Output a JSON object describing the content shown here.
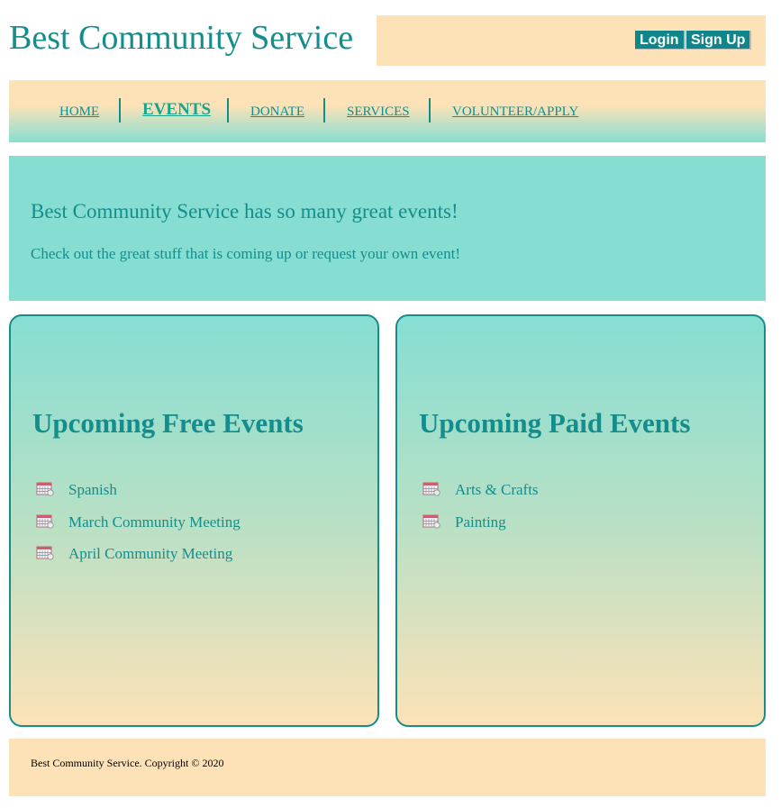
{
  "header": {
    "title": "Best Community Service",
    "login_label": "Login",
    "signup_label": "Sign Up"
  },
  "nav": {
    "items": [
      {
        "label": "HOME"
      },
      {
        "label": "EVENTS",
        "active": true
      },
      {
        "label": "DONATE"
      },
      {
        "label": "SERVICES"
      },
      {
        "label": "VOLUNTEER/APPLY"
      }
    ]
  },
  "hero": {
    "heading": "Best Community Service has so many great events!",
    "text": "Check out the great stuff that is coming up or request your own event!"
  },
  "free_events": {
    "title": "Upcoming Free Events",
    "items": [
      {
        "label": "Spanish",
        "icon": "calendar-icon"
      },
      {
        "label": "March Community Meeting",
        "icon": "calendar-icon"
      },
      {
        "label": "April Community Meeting",
        "icon": "calendar-icon"
      }
    ]
  },
  "paid_events": {
    "title": "Upcoming Paid Events",
    "items": [
      {
        "label": "Arts & Crafts",
        "icon": "calendar-icon"
      },
      {
        "label": "Painting",
        "icon": "calendar-icon"
      }
    ]
  },
  "footer": {
    "text": "Best Community Service. Copyright © 2020"
  },
  "colors": {
    "teal": "#158d8d",
    "mint": "#86ded2",
    "peach": "#fde2b7",
    "button": "#0f878a"
  }
}
